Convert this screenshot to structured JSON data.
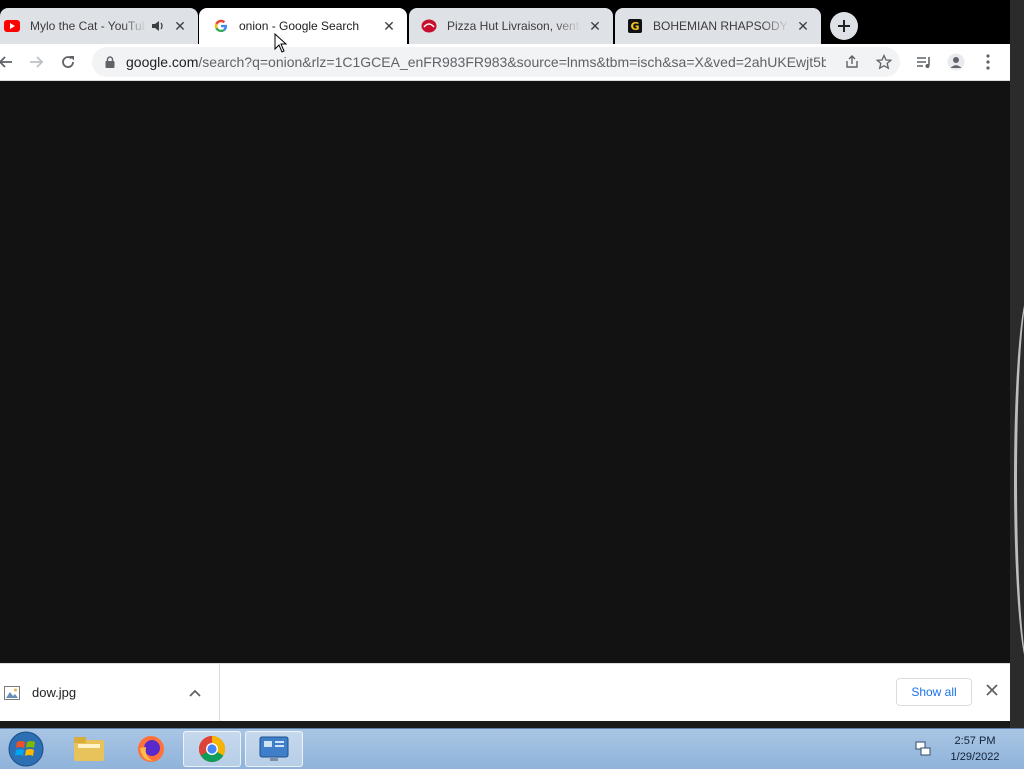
{
  "browser": {
    "tabs": [
      {
        "title": "Mylo the Cat - YouTube",
        "favicon": "youtube-icon",
        "audio": true,
        "active": false
      },
      {
        "title": "onion - Google Search",
        "favicon": "google-icon",
        "active": true
      },
      {
        "title": "Pizza Hut Livraison, vente à emporter",
        "favicon": "pizza-hut-icon",
        "active": false
      },
      {
        "title": "BOHEMIAN RHAPSODY CHORDS",
        "favicon": "g-letter-icon",
        "active": false
      }
    ],
    "url_host": "google.com",
    "url_path": "/search?q=onion&rlz=1C1GCEA_enFR983FR983&source=lnms&tbm=isch&sa=X&ved=2ahUKEwjt5b..."
  },
  "downloads": {
    "file_name": "dow.jpg",
    "show_all_label": "Show all"
  },
  "taskbar": {
    "time": "2:57 PM",
    "date": "1/29/2022"
  },
  "colors": {
    "tab_strip": "#000000",
    "content_bg": "#121212",
    "link_blue": "#1a73e8",
    "taskbar": "#a9c5e4"
  }
}
